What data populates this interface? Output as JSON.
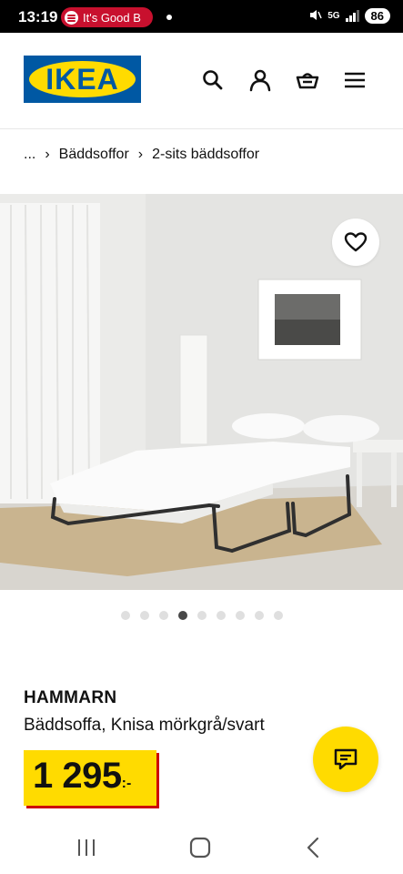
{
  "status_bar": {
    "time": "13:19",
    "notification_pill": "It's Good B",
    "network": "5G",
    "battery": "86"
  },
  "header": {
    "logo_text": "IKEA",
    "icons": [
      "search-icon",
      "account-icon",
      "basket-icon",
      "menu-icon"
    ]
  },
  "breadcrumb": {
    "ellipsis": "...",
    "items": [
      "Bäddsoffor",
      "2-sits bäddsoffor"
    ]
  },
  "gallery": {
    "image_count": 9,
    "active_index": 3
  },
  "product": {
    "name": "HAMMARN",
    "description": "Bäddsoffa, Knisa mörkgrå/svart",
    "price_integer": "1 295",
    "price_suffix": ":-"
  },
  "colors": {
    "ikea_blue": "#0058a3",
    "ikea_yellow": "#ffdb00",
    "price_shadow_red": "#cc0008",
    "status_pill_red": "#c8102e"
  }
}
